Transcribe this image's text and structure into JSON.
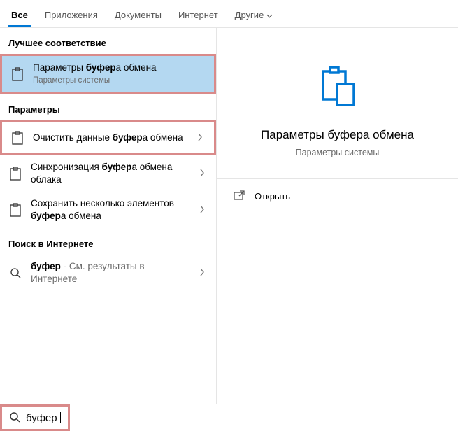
{
  "tabs": {
    "all": "Все",
    "apps": "Приложения",
    "docs": "Документы",
    "web": "Интернет",
    "more": "Другие"
  },
  "sections": {
    "best_match": "Лучшее соответствие",
    "settings": "Параметры",
    "web": "Поиск в Интернете"
  },
  "results": {
    "best": {
      "title_pre": "Параметры ",
      "title_bold": "буфер",
      "title_post": "а обмена",
      "sub": "Параметры системы"
    },
    "s1": {
      "pre": "Очистить данные ",
      "bold": "буфер",
      "post": "а обмена"
    },
    "s2": {
      "pre": "Синхронизация ",
      "bold": "буфер",
      "post": "а обмена облака"
    },
    "s3": {
      "pre": "Сохранить несколько элементов ",
      "bold": "буфер",
      "post": "а обмена"
    },
    "web": {
      "bold": "буфер",
      "post": " - См. результаты в Интернете"
    }
  },
  "detail": {
    "title": "Параметры буфера обмена",
    "sub": "Параметры системы",
    "open": "Открыть"
  },
  "search": {
    "value": "буфер"
  },
  "colors": {
    "accent": "#0078d4",
    "highlight": "#d98a8a",
    "selection": "#b4d8f1"
  }
}
